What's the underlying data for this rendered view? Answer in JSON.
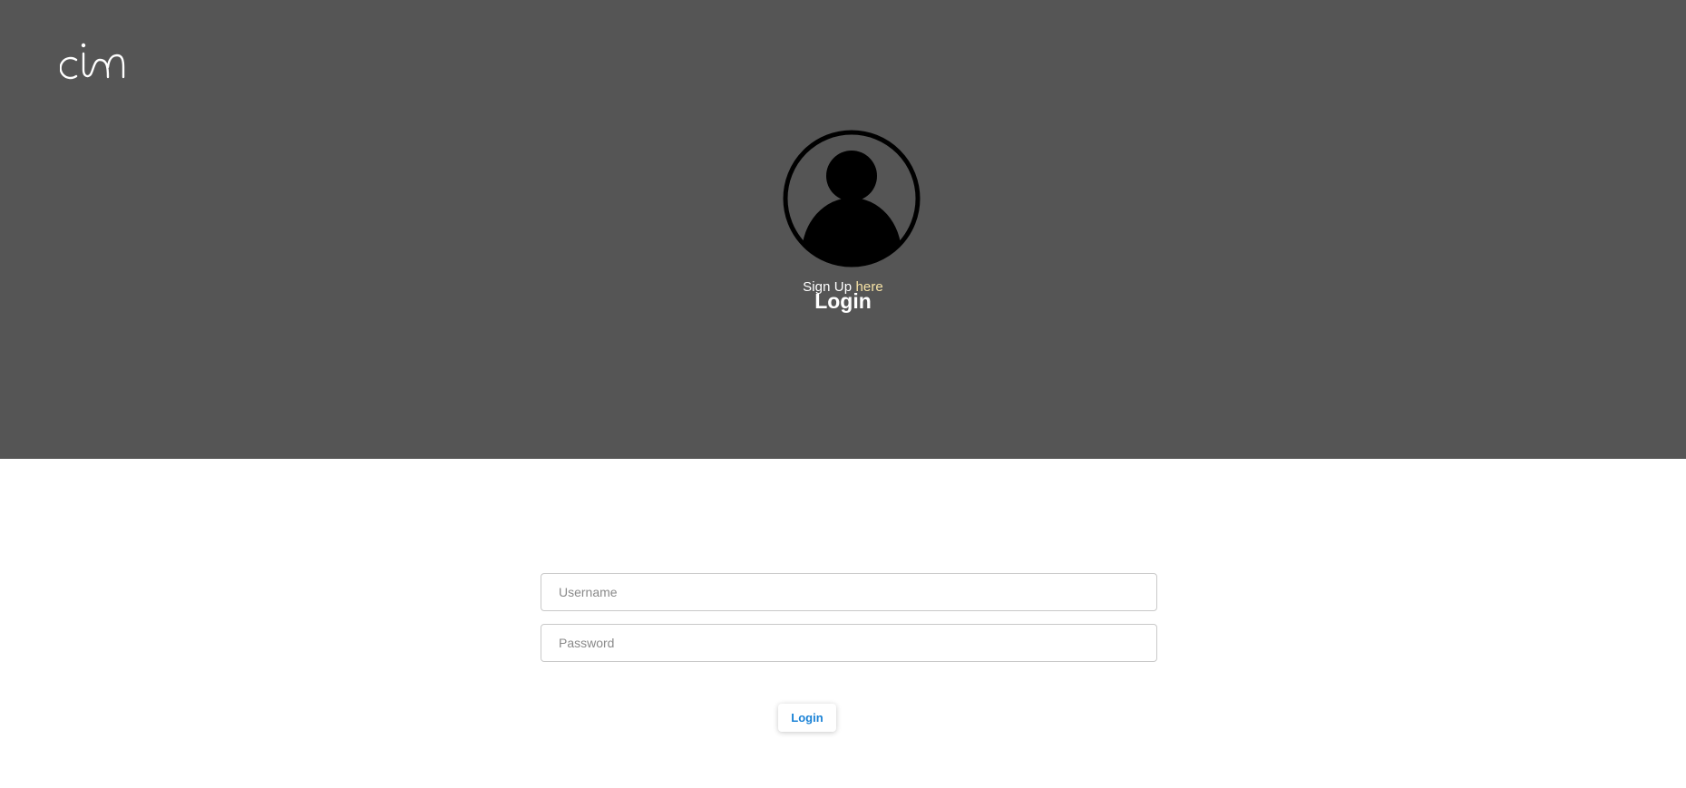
{
  "brand": {
    "logo_icon": "cin-logo-icon",
    "logo_text": "cin"
  },
  "header": {
    "avatar_icon": "user-avatar-icon",
    "signup_prefix": "Sign Up ",
    "signup_link": "here",
    "title": "Login"
  },
  "form": {
    "username_placeholder": "Username",
    "username_value": "",
    "password_placeholder": "Password",
    "password_value": "",
    "submit_label": "Login"
  },
  "colors": {
    "hero_background": "#555555",
    "page_background": "#ffffff",
    "link_accent": "#f7e3a6",
    "button_text": "#1a82d6"
  }
}
